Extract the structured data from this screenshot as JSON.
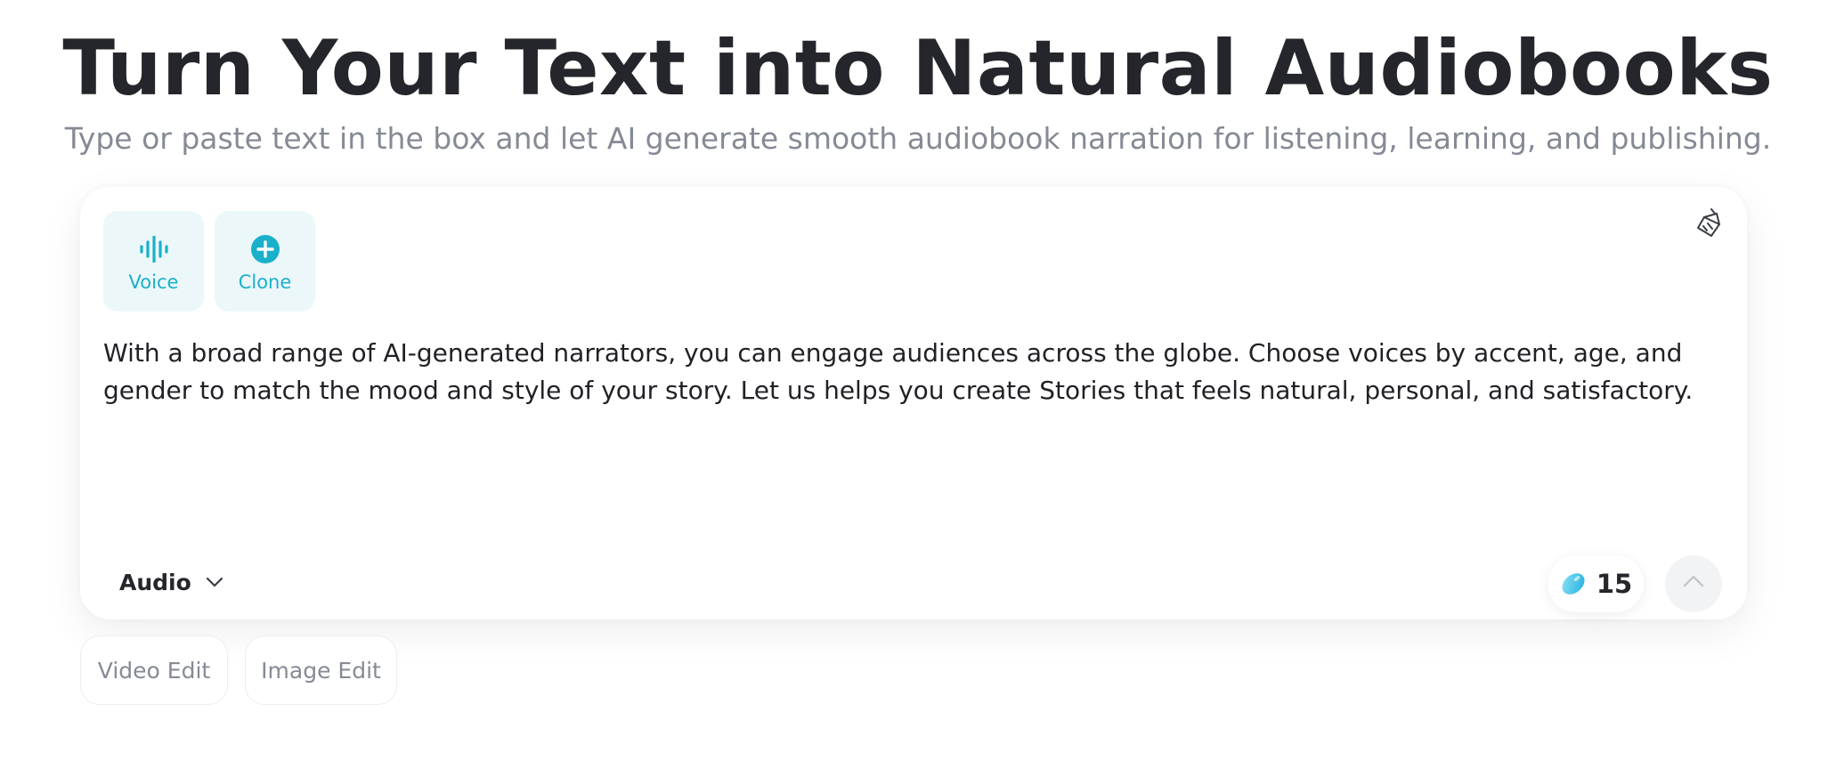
{
  "hero": {
    "title": "Turn Your Text into Natural Audiobooks",
    "subtitle": "Type or paste text in the box and let AI generate smooth audiobook narration for listening, learning, and publishing."
  },
  "editor": {
    "modes": [
      {
        "label": "Voice",
        "icon": "waveform-icon"
      },
      {
        "label": "Clone",
        "icon": "plus-circle-icon"
      }
    ],
    "clear_icon": "broom-icon",
    "prompt_text": "With a broad range of AI-generated narrators, you can engage audiences across the globe. Choose voices by accent, age, and gender to match the mood and style of your story. Let us helps you create Stories that feels natural, personal, and satisfactory.",
    "output_type": {
      "selected": "Audio",
      "icon": "chevron-down-icon"
    },
    "credits": {
      "count": "15",
      "icon": "gem-icon"
    },
    "send_icon": "arrow-up-icon"
  },
  "tools": [
    {
      "label": "Video Edit"
    },
    {
      "label": "Image Edit"
    }
  ],
  "colors": {
    "accent": "#1ab0c9",
    "mode_button_bg": "#ecf7fa",
    "title": "#24262b",
    "subtitle": "#858a94",
    "send_bg": "#f2f3f5"
  }
}
